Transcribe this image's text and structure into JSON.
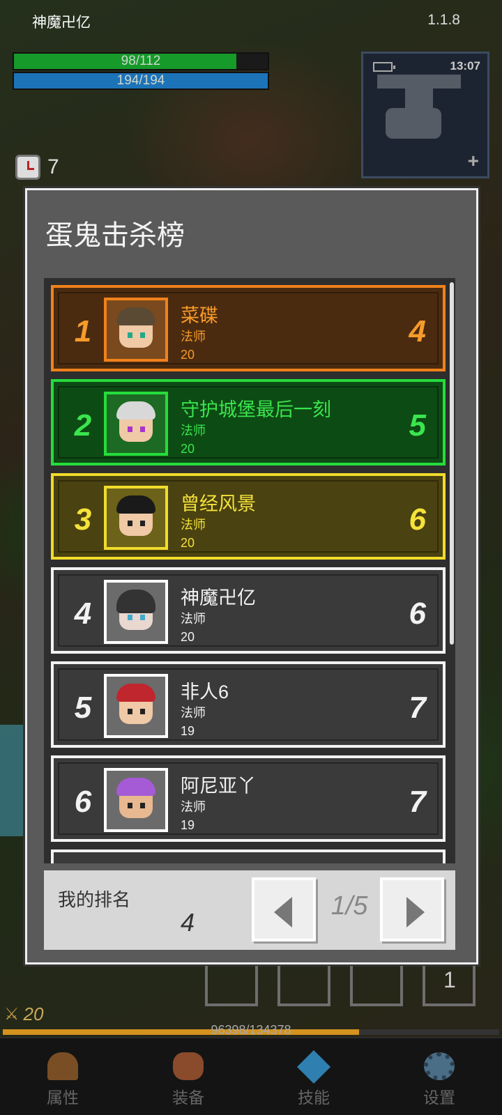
{
  "hud": {
    "player_name": "神魔卍亿",
    "version": "1.1.8",
    "hp_text": "98/112",
    "hp_fraction": 0.875,
    "mp_text": "194/194",
    "mp_fraction": 1.0,
    "clock": "13:07",
    "timer_value": "7"
  },
  "panel": {
    "title": "蛋鬼击杀榜",
    "entries": [
      {
        "rank": "1",
        "name": "菜碟",
        "class": "法师",
        "level": "20",
        "kills": "4"
      },
      {
        "rank": "2",
        "name": "守护城堡最后一刻",
        "class": "法师",
        "level": "20",
        "kills": "5"
      },
      {
        "rank": "3",
        "name": "曾经风景",
        "class": "法师",
        "level": "20",
        "kills": "6"
      },
      {
        "rank": "4",
        "name": "神魔卍亿",
        "class": "法师",
        "level": "20",
        "kills": "6"
      },
      {
        "rank": "5",
        "name": "非人6",
        "class": "法师",
        "level": "19",
        "kills": "7"
      },
      {
        "rank": "6",
        "name": "阿尼亚丫",
        "class": "法师",
        "level": "19",
        "kills": "7"
      }
    ],
    "my_rank_label": "我的排名",
    "my_rank_value": "4",
    "page_indicator": "1/5"
  },
  "bottom": {
    "slot_count": "1",
    "player_level": "20",
    "xp_text": "96398/134378",
    "xp_fraction": 0.717
  },
  "nav": {
    "attributes": "属性",
    "equipment": "装备",
    "skills": "技能",
    "settings": "设置"
  },
  "colors": {
    "gold_rank": "#f0821c",
    "green_rank": "#26dc3c",
    "yellow_rank": "#f1dc2c",
    "hp": "#169a2a",
    "mp": "#1c73b8"
  }
}
